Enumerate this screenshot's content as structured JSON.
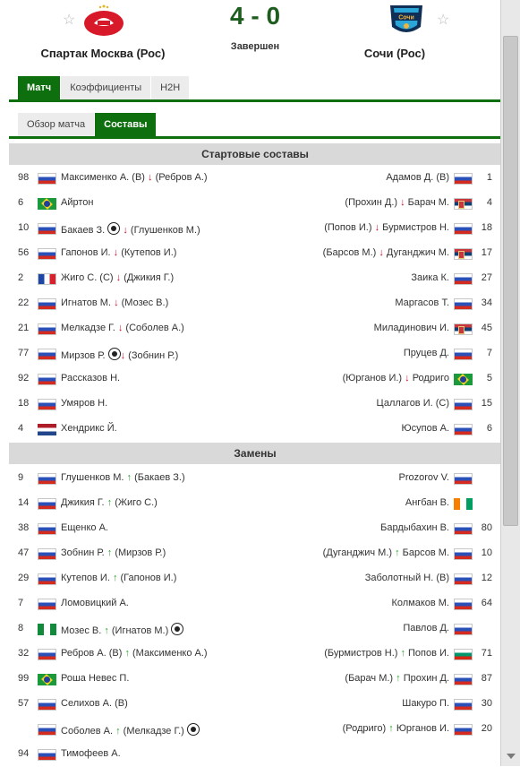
{
  "match": {
    "home_team": "Спартак Москва (Рос)",
    "away_team": "Сочи (Рос)",
    "score": "4 - 0",
    "status": "Завершен",
    "away_logo_text": "Сочи"
  },
  "tabs": [
    {
      "label": "Матч",
      "active": true
    },
    {
      "label": "Коэффициенты",
      "active": false
    },
    {
      "label": "H2H",
      "active": false
    }
  ],
  "sub_tabs": [
    {
      "label": "Обзор матча",
      "active": false
    },
    {
      "label": "Составы",
      "active": true
    }
  ],
  "starting": {
    "title": "Стартовые составы",
    "rows": [
      {
        "home_num": "98",
        "home_flag": "ru",
        "home": [
          {
            "t": "Максименко А. (В) "
          },
          {
            "i": "down"
          },
          {
            "t": " (Ребров А.)"
          }
        ],
        "away": [
          {
            "t": "Адамов Д. (В)"
          }
        ],
        "away_flag": "ru",
        "away_num": "1"
      },
      {
        "home_num": "6",
        "home_flag": "br",
        "home": [
          {
            "t": "Айртон"
          }
        ],
        "away": [
          {
            "t": "(Прохин Д.) "
          },
          {
            "i": "down"
          },
          {
            "t": " Барач М."
          }
        ],
        "away_flag": "rs",
        "away_num": "4"
      },
      {
        "home_num": "10",
        "home_flag": "ru",
        "home": [
          {
            "t": "Бакаев З. "
          },
          {
            "i": "ball"
          },
          {
            "t": " "
          },
          {
            "i": "down"
          },
          {
            "t": " (Глушенков М.)"
          }
        ],
        "away": [
          {
            "t": "(Попов И.) "
          },
          {
            "i": "down"
          },
          {
            "t": " Бурмистров Н."
          }
        ],
        "away_flag": "ru",
        "away_num": "18"
      },
      {
        "home_num": "56",
        "home_flag": "ru",
        "home": [
          {
            "t": "Гапонов И. "
          },
          {
            "i": "down"
          },
          {
            "t": " (Кутепов И.)"
          }
        ],
        "away": [
          {
            "t": "(Барсов М.) "
          },
          {
            "i": "down"
          },
          {
            "t": " Дуганджич М."
          }
        ],
        "away_flag": "rs",
        "away_num": "17"
      },
      {
        "home_num": "2",
        "home_flag": "fr",
        "home": [
          {
            "t": "Жиго С. (C) "
          },
          {
            "i": "down"
          },
          {
            "t": " (Джикия Г.)"
          }
        ],
        "away": [
          {
            "t": "Заика К."
          }
        ],
        "away_flag": "ru",
        "away_num": "27"
      },
      {
        "home_num": "22",
        "home_flag": "ru",
        "home": [
          {
            "t": "Игнатов М. "
          },
          {
            "i": "down"
          },
          {
            "t": " (Мозес В.)"
          }
        ],
        "away": [
          {
            "t": "Маргасов Т."
          }
        ],
        "away_flag": "ru",
        "away_num": "34"
      },
      {
        "home_num": "21",
        "home_flag": "ru",
        "home": [
          {
            "t": "Мелкадзе Г. "
          },
          {
            "i": "down"
          },
          {
            "t": " (Соболев А.)"
          }
        ],
        "away": [
          {
            "t": "Миладинович И."
          }
        ],
        "away_flag": "rs",
        "away_num": "45"
      },
      {
        "home_num": "77",
        "home_flag": "ru",
        "home": [
          {
            "t": "Мирзов Р. "
          },
          {
            "i": "ball"
          },
          {
            "i": "down"
          },
          {
            "t": " (Зобнин Р.)"
          }
        ],
        "away": [
          {
            "t": "Пруцев Д."
          }
        ],
        "away_flag": "ru",
        "away_num": "7"
      },
      {
        "home_num": "92",
        "home_flag": "ru",
        "home": [
          {
            "t": "Рассказов Н."
          }
        ],
        "away": [
          {
            "t": "(Юрганов И.) "
          },
          {
            "i": "down"
          },
          {
            "t": " Родриго"
          }
        ],
        "away_flag": "br",
        "away_num": "5"
      },
      {
        "home_num": "18",
        "home_flag": "ru",
        "home": [
          {
            "t": "Умяров Н."
          }
        ],
        "away": [
          {
            "t": "Цаллагов И. (C)"
          }
        ],
        "away_flag": "ru",
        "away_num": "15"
      },
      {
        "home_num": "4",
        "home_flag": "nl",
        "home": [
          {
            "t": "Хендрикс Й."
          }
        ],
        "away": [
          {
            "t": "Юсупов А."
          }
        ],
        "away_flag": "ru",
        "away_num": "6"
      }
    ]
  },
  "subs": {
    "title": "Замены",
    "rows": [
      {
        "home_num": "9",
        "home_flag": "ru",
        "home": [
          {
            "t": "Глушенков М. "
          },
          {
            "i": "up"
          },
          {
            "t": " (Бакаев З.)"
          }
        ],
        "away": [
          {
            "t": "Prozorov V."
          }
        ],
        "away_flag": "ru",
        "away_num": ""
      },
      {
        "home_num": "14",
        "home_flag": "ru",
        "home": [
          {
            "t": "Джикия Г. "
          },
          {
            "i": "up"
          },
          {
            "t": " (Жиго С.)"
          }
        ],
        "away": [
          {
            "t": "Ангбан В."
          }
        ],
        "away_flag": "ci",
        "away_num": ""
      },
      {
        "home_num": "38",
        "home_flag": "ru",
        "home": [
          {
            "t": "Ещенко А."
          }
        ],
        "away": [
          {
            "t": "Бардыбахин В."
          }
        ],
        "away_flag": "ru",
        "away_num": "80"
      },
      {
        "home_num": "47",
        "home_flag": "ru",
        "home": [
          {
            "t": "Зобнин Р. "
          },
          {
            "i": "up"
          },
          {
            "t": " (Мирзов Р.)"
          }
        ],
        "away": [
          {
            "t": "(Дуганджич М.) "
          },
          {
            "i": "up"
          },
          {
            "t": " Барсов М."
          }
        ],
        "away_flag": "ru",
        "away_num": "10"
      },
      {
        "home_num": "29",
        "home_flag": "ru",
        "home": [
          {
            "t": "Кутепов И. "
          },
          {
            "i": "up"
          },
          {
            "t": " (Гапонов И.)"
          }
        ],
        "away": [
          {
            "t": "Заболотный Н. (В)"
          }
        ],
        "away_flag": "ru",
        "away_num": "12"
      },
      {
        "home_num": "7",
        "home_flag": "ru",
        "home": [
          {
            "t": "Ломовицкий А."
          }
        ],
        "away": [
          {
            "t": "Колмаков М."
          }
        ],
        "away_flag": "ru",
        "away_num": "64"
      },
      {
        "home_num": "8",
        "home_flag": "ng",
        "home": [
          {
            "t": "Мозес В. "
          },
          {
            "i": "up"
          },
          {
            "t": " (Игнатов М.) "
          },
          {
            "i": "ball"
          }
        ],
        "away": [
          {
            "t": "Павлов Д."
          }
        ],
        "away_flag": "ru",
        "away_num": ""
      },
      {
        "home_num": "32",
        "home_flag": "ru",
        "home": [
          {
            "t": "Ребров А. (В) "
          },
          {
            "i": "up"
          },
          {
            "t": " (Максименко А.)"
          }
        ],
        "away": [
          {
            "t": "(Бурмистров Н.) "
          },
          {
            "i": "up"
          },
          {
            "t": " Попов И."
          }
        ],
        "away_flag": "bg",
        "away_num": "71"
      },
      {
        "home_num": "99",
        "home_flag": "br",
        "home": [
          {
            "t": "Роша Невес П."
          }
        ],
        "away": [
          {
            "t": "(Барач М.) "
          },
          {
            "i": "up"
          },
          {
            "t": " Прохин Д."
          }
        ],
        "away_flag": "ru",
        "away_num": "87"
      },
      {
        "home_num": "57",
        "home_flag": "ru",
        "home": [
          {
            "t": "Селихов А. (В)"
          }
        ],
        "away": [
          {
            "t": "Шакуро П."
          }
        ],
        "away_flag": "ru",
        "away_num": "30"
      },
      {
        "home_num": "",
        "home_flag": "ru",
        "home": [
          {
            "t": "Соболев А. "
          },
          {
            "i": "up"
          },
          {
            "t": " (Мелкадзе Г.) "
          },
          {
            "i": "ball"
          }
        ],
        "away": [
          {
            "t": "(Родриго) "
          },
          {
            "i": "up"
          },
          {
            "t": " Юрганов И."
          }
        ],
        "away_flag": "ru",
        "away_num": "20"
      },
      {
        "home_num": "94",
        "home_flag": "ru",
        "home": [
          {
            "t": "Тимофеев А."
          }
        ],
        "away": [],
        "away_flag": "",
        "away_num": ""
      }
    ]
  },
  "colors": {
    "accent": "#0d6f0d",
    "header_bg": "#d9d9d9",
    "sub_out": "#c8102e",
    "sub_in": "#2fa52f"
  }
}
